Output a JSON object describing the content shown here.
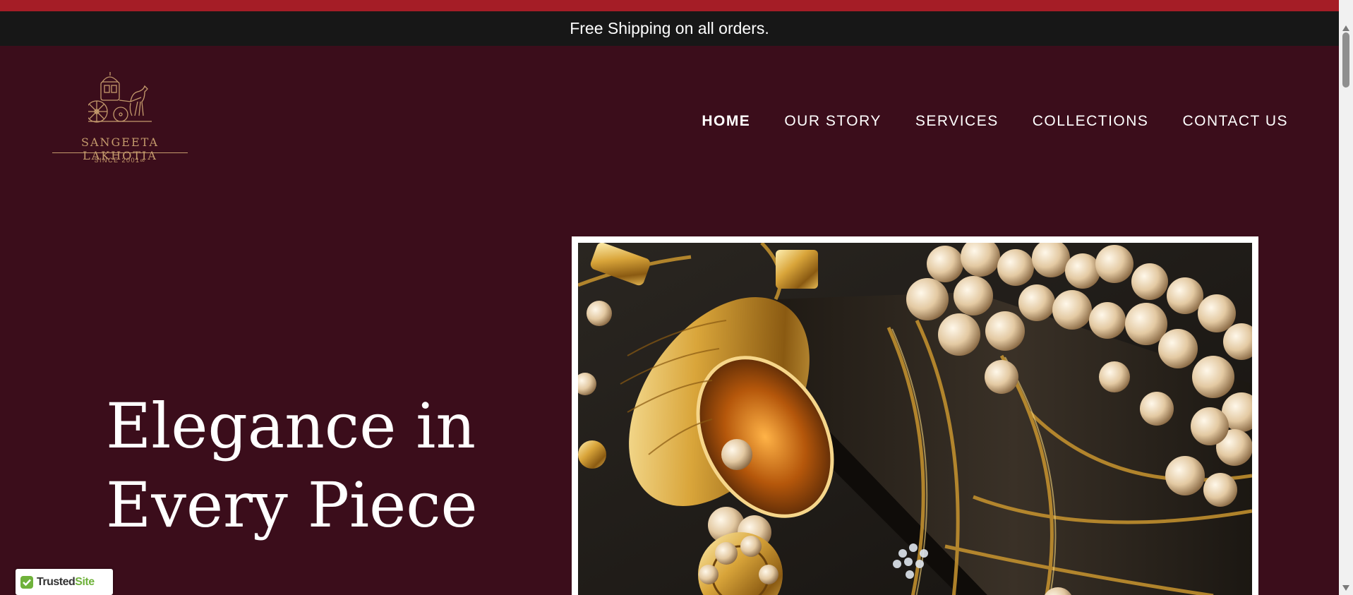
{
  "announcement": {
    "text": "Free Shipping on all orders."
  },
  "brand": {
    "name": "SANGEETA LAKHOTIA",
    "tagline": "SINCE 2001∞",
    "logo_icon": "horse-carriage-icon",
    "color": "#c49a6c"
  },
  "nav": {
    "items": [
      {
        "label": "HOME",
        "active": true
      },
      {
        "label": "OUR STORY",
        "active": false
      },
      {
        "label": "SERVICES",
        "active": false
      },
      {
        "label": "COLLECTIONS",
        "active": false
      },
      {
        "label": "CONTACT US",
        "active": false
      }
    ]
  },
  "hero": {
    "title_line1": "Elegance in",
    "title_line2": "Every Piece",
    "image": "jewelry-pearls-gold-photo"
  },
  "badge": {
    "label_part1": "Trusted",
    "label_part2": "Site",
    "icon": "check-shield-icon"
  },
  "colors": {
    "accent_strip": "#a51d26",
    "announcement_bg": "#171717",
    "page_bg": "#3b0d1b",
    "badge_green": "#6fb23b"
  }
}
